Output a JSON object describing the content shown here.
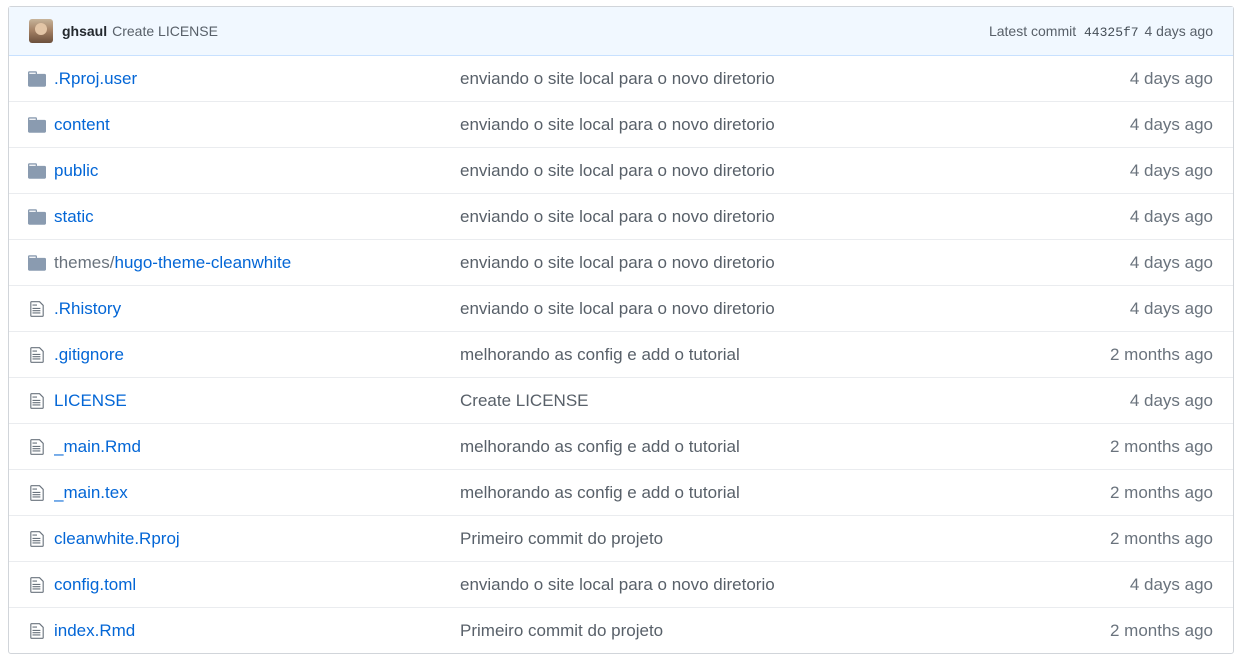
{
  "commit": {
    "author": "ghsaul",
    "message": "Create LICENSE",
    "latest_label": "Latest commit",
    "sha": "44325f7",
    "age": "4 days ago"
  },
  "files": [
    {
      "type": "dir",
      "prefix": "",
      "name": ".Rproj.user",
      "message": "enviando o site local para o novo diretorio",
      "age": "4 days ago"
    },
    {
      "type": "dir",
      "prefix": "",
      "name": "content",
      "message": "enviando o site local para o novo diretorio",
      "age": "4 days ago"
    },
    {
      "type": "dir",
      "prefix": "",
      "name": "public",
      "message": "enviando o site local para o novo diretorio",
      "age": "4 days ago"
    },
    {
      "type": "dir",
      "prefix": "",
      "name": "static",
      "message": "enviando o site local para o novo diretorio",
      "age": "4 days ago"
    },
    {
      "type": "dir",
      "prefix": "themes/",
      "name": "hugo-theme-cleanwhite",
      "message": "enviando o site local para o novo diretorio",
      "age": "4 days ago"
    },
    {
      "type": "file",
      "prefix": "",
      "name": ".Rhistory",
      "message": "enviando o site local para o novo diretorio",
      "age": "4 days ago"
    },
    {
      "type": "file",
      "prefix": "",
      "name": ".gitignore",
      "message": "melhorando as config e add o tutorial",
      "age": "2 months ago"
    },
    {
      "type": "file",
      "prefix": "",
      "name": "LICENSE",
      "message": "Create LICENSE",
      "age": "4 days ago"
    },
    {
      "type": "file",
      "prefix": "",
      "name": "_main.Rmd",
      "message": "melhorando as config e add o tutorial",
      "age": "2 months ago"
    },
    {
      "type": "file",
      "prefix": "",
      "name": "_main.tex",
      "message": "melhorando as config e add o tutorial",
      "age": "2 months ago"
    },
    {
      "type": "file",
      "prefix": "",
      "name": "cleanwhite.Rproj",
      "message": "Primeiro commit do projeto",
      "age": "2 months ago"
    },
    {
      "type": "file",
      "prefix": "",
      "name": "config.toml",
      "message": "enviando o site local para o novo diretorio",
      "age": "4 days ago"
    },
    {
      "type": "file",
      "prefix": "",
      "name": "index.Rmd",
      "message": "Primeiro commit do projeto",
      "age": "2 months ago"
    }
  ],
  "colors": {
    "folder": "#79b8ff",
    "folder_dark": "#8899aa",
    "file": "#6a737d",
    "link": "#0366d6"
  },
  "icons": {
    "dir": "folder-icon",
    "file": "file-icon"
  }
}
